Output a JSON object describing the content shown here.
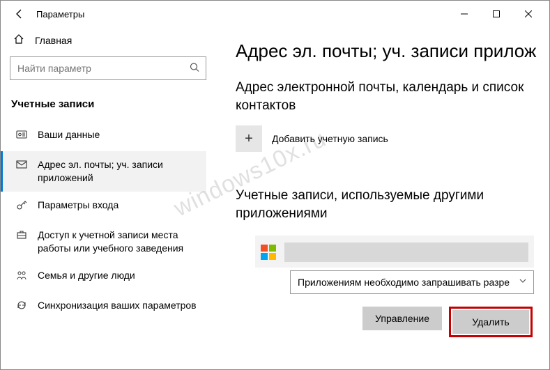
{
  "window": {
    "title": "Параметры"
  },
  "sidebar": {
    "home": "Главная",
    "search_placeholder": "Найти параметр",
    "category": "Учетные записи",
    "items": [
      {
        "icon": "person-icon",
        "label": "Ваши данные"
      },
      {
        "icon": "mail-icon",
        "label": "Адрес эл. почты; уч. записи приложений"
      },
      {
        "icon": "key-icon",
        "label": "Параметры входа"
      },
      {
        "icon": "briefcase-icon",
        "label": "Доступ к учетной записи места работы или учебного заведения"
      },
      {
        "icon": "family-icon",
        "label": "Семья и другие люди"
      },
      {
        "icon": "sync-icon",
        "label": "Синхронизация ваших параметров"
      }
    ]
  },
  "page": {
    "title": "Адрес эл. почты; уч. записи прилож",
    "section1": "Адрес электронной почты, календарь и список контактов",
    "add_account": "Добавить учетную запись",
    "section2": "Учетные записи, используемые другими приложениями",
    "account_select": "Приложениям необходимо запрашивать разре",
    "manage": "Управление",
    "delete": "Удалить"
  },
  "watermark": "windows10x.ru"
}
